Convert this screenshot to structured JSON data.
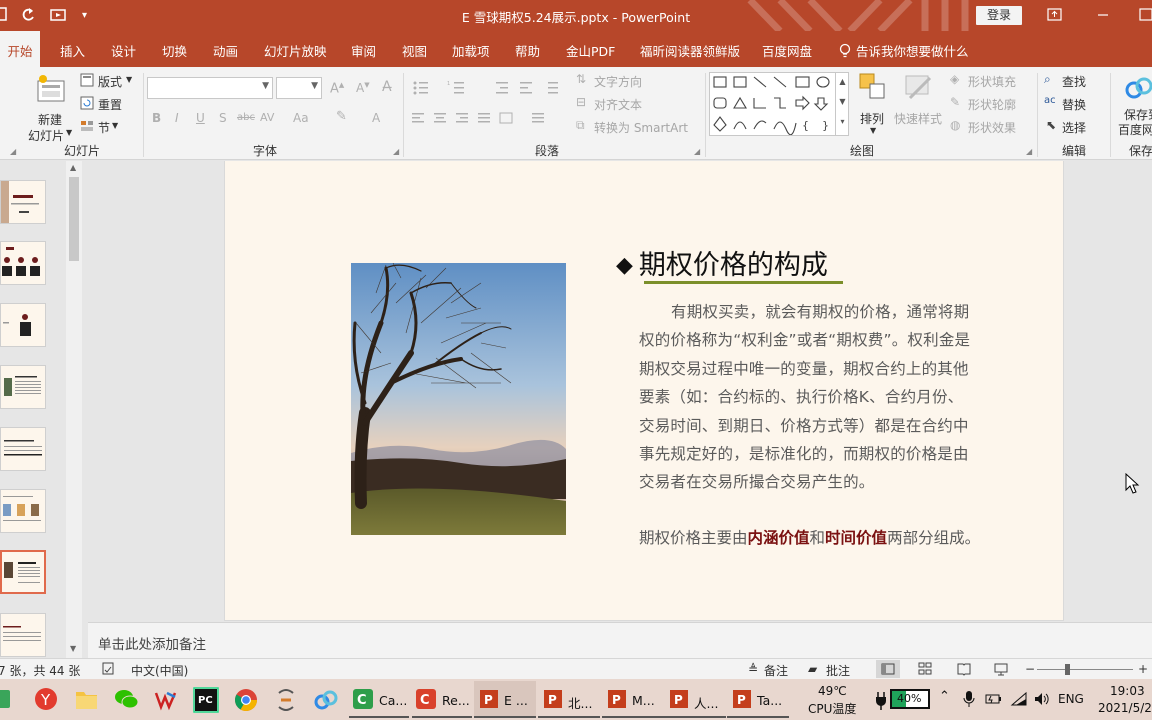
{
  "window": {
    "title_file": "E 雪球期权5.24展示.pptx",
    "title_sep": "-",
    "title_app": "PowerPoint",
    "login_label": "登录"
  },
  "tabs": [
    "开始",
    "插入",
    "设计",
    "切换",
    "动画",
    "幻灯片放映",
    "审阅",
    "视图",
    "加载项",
    "帮助",
    "金山PDF",
    "福昕阅读器领鲜版",
    "百度网盘"
  ],
  "tell_me": "告诉我你想要做什么",
  "ribbon": {
    "groups": {
      "slides": "幻灯片",
      "font": "字体",
      "paragraph": "段落",
      "drawing": "绘图",
      "editing": "编辑",
      "save": "保存"
    },
    "slides": {
      "new_slide_line1": "新建",
      "new_slide_line2": "幻灯片",
      "layout": "版式",
      "reset": "重置",
      "section": "节"
    },
    "font_tools": [
      "B",
      "I",
      "U",
      "S",
      "abc",
      "AV",
      "Aa",
      "A"
    ],
    "paragraph": {
      "text_direction": "文字方向",
      "align_text": "对齐文本",
      "convert_smartart": "转换为 SmartArt"
    },
    "drawing": {
      "arrange": "排列",
      "quick_styles": "快速样式",
      "shape_fill": "形状填充",
      "shape_outline": "形状轮廓",
      "shape_effects": "形状效果"
    },
    "editing": {
      "find": "查找",
      "replace": "替换",
      "select": "选择"
    },
    "save": {
      "line1": "保存到",
      "line2": "百度网"
    }
  },
  "slide": {
    "heading": "期权价格的构成",
    "body": "有期权买卖，就会有期权的价格，通常将期权的价格称为“权利金”或者“期权费”。权利金是期权交易过程中唯一的变量，期权合约上的其他要素（如：合约标的、执行价格K、合约月份、交易时间、到期日、价格方式等）都是在合约中事先规定好的，是标准化的，而期权的价格是由交易者在交易所撮合交易产生的。",
    "summary_prefix": "期权价格主要由",
    "summary_term1": "内涵价值",
    "summary_and": "和",
    "summary_term2": "时间价值",
    "summary_suffix": "两部分组成。"
  },
  "notes_placeholder": "单击此处添加备注",
  "status": {
    "slide_count": "7 张，共 44 张",
    "language": "中文(中国)",
    "notes": "备注",
    "comments": "批注"
  },
  "taskbar": {
    "apps": [
      {
        "label": "Ca...",
        "icon": "c-app-icon"
      },
      {
        "label": "Re...",
        "icon": "record-icon"
      },
      {
        "label": "E ...",
        "icon": "powerpoint-icon"
      },
      {
        "label": "北...",
        "icon": "powerpoint-icon"
      },
      {
        "label": "M...",
        "icon": "powerpoint-icon"
      },
      {
        "label": "人...",
        "icon": "powerpoint-icon"
      },
      {
        "label": "Ta...",
        "icon": "powerpoint-icon"
      }
    ],
    "cpu_temp": "49℃",
    "cpu_label": "CPU温度",
    "battery": "40%",
    "lang": "ENG",
    "time": "19:03",
    "date": "2021/5/2"
  },
  "colors": {
    "brand": "#b7472a",
    "slide_bg": "#fdf6ec",
    "heading_underline": "#7b8f2a",
    "emphasis": "#7b1212"
  }
}
